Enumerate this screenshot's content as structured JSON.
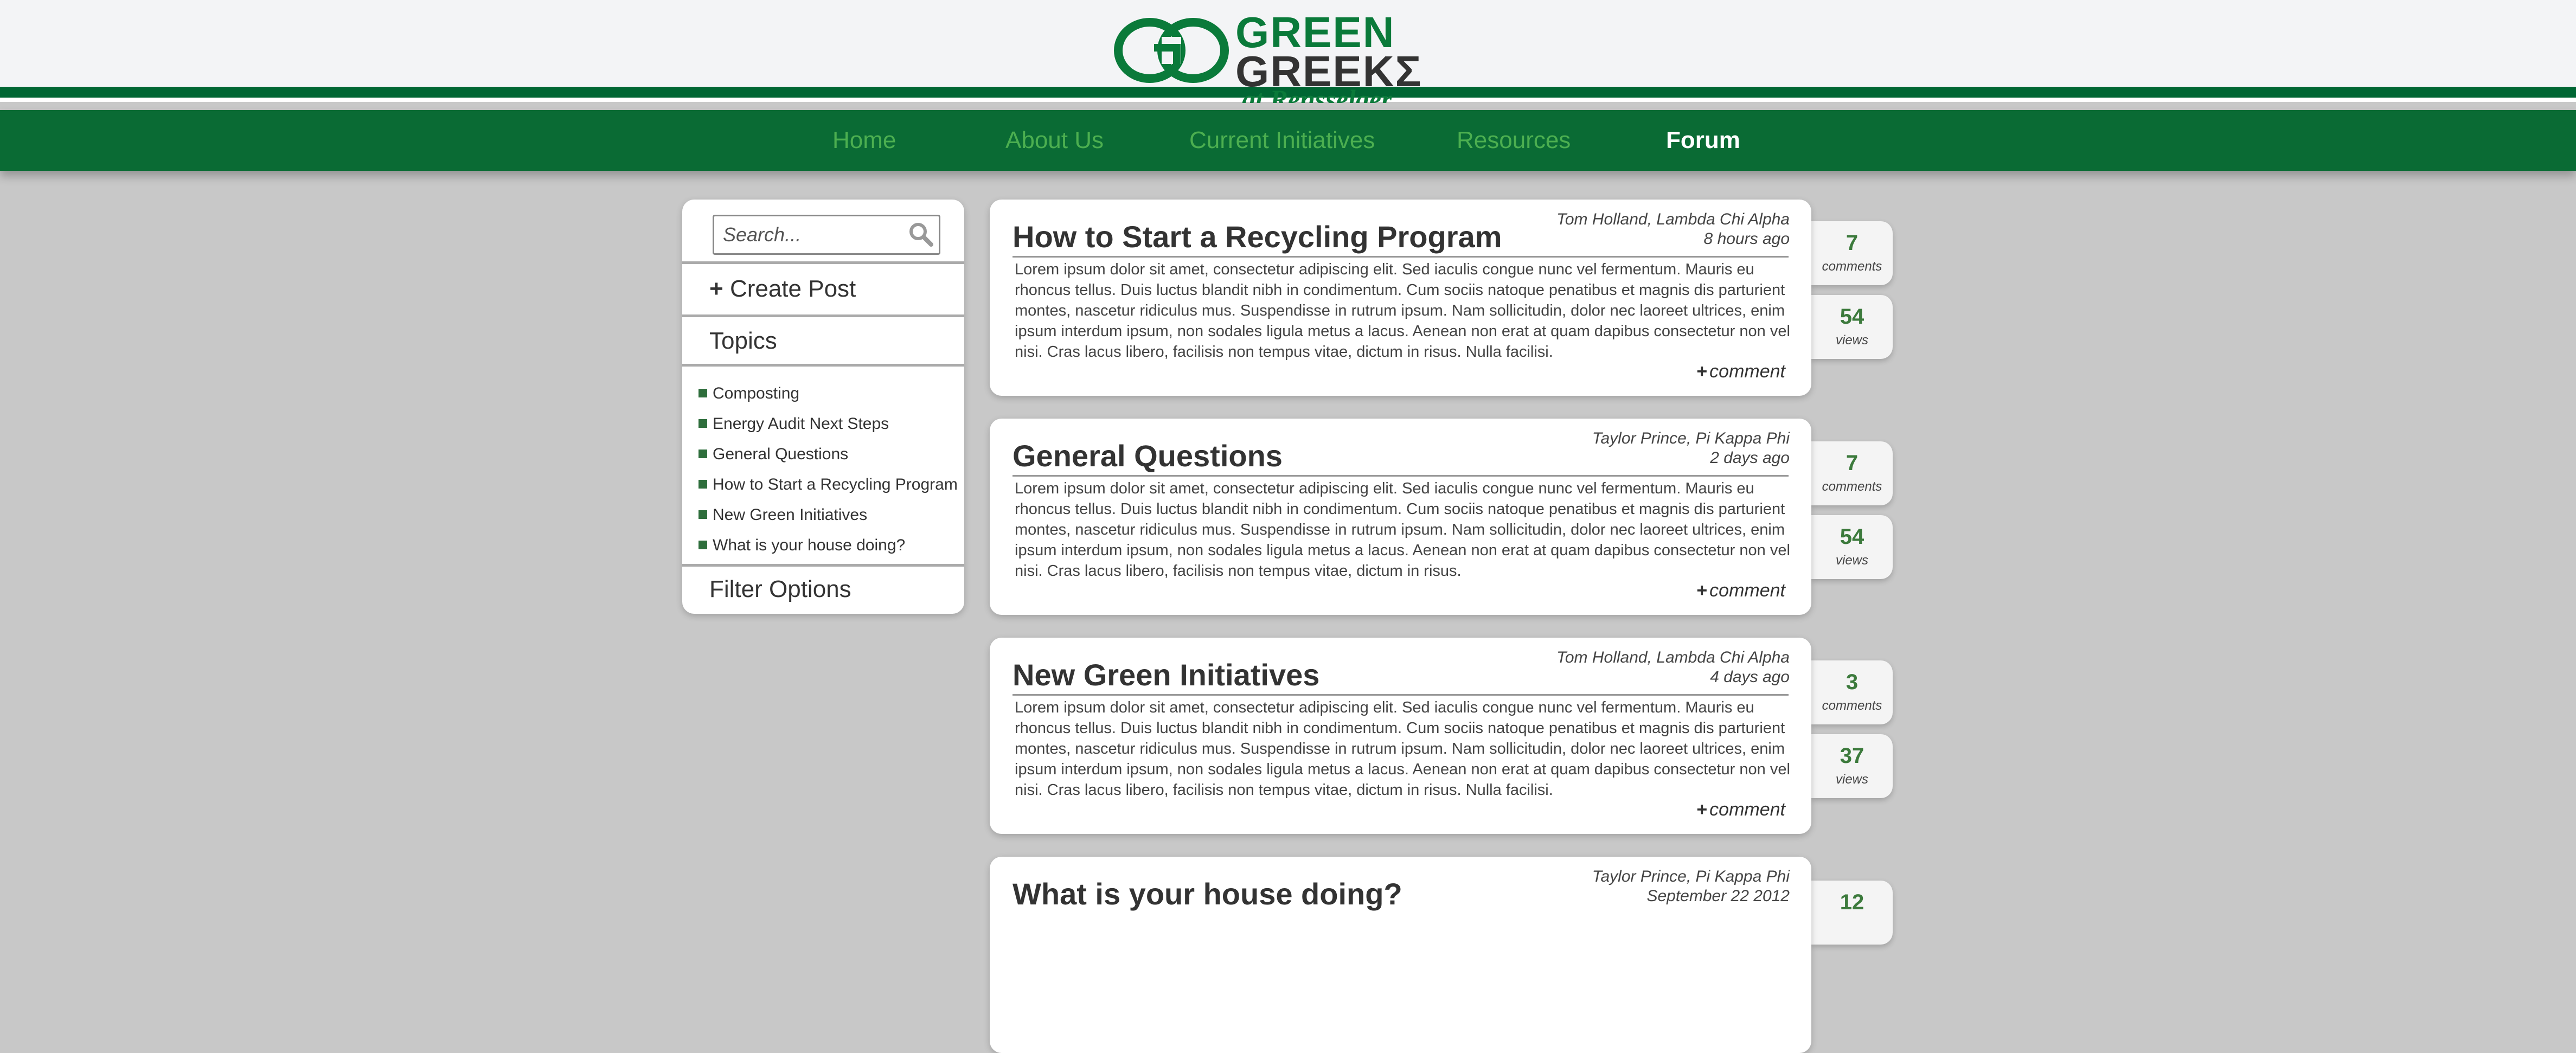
{
  "brand": {
    "line1": "GREEN",
    "line2": "GREEKΣ",
    "line3": "at Rensselaer",
    "colors": {
      "green": "#0a6b34",
      "accent": "#4caf50",
      "stat_green": "#3c7a3c"
    }
  },
  "nav": {
    "items": [
      {
        "label": "Home",
        "active": false
      },
      {
        "label": "About Us",
        "active": false
      },
      {
        "label": "Current Initiatives",
        "active": false
      },
      {
        "label": "Resources",
        "active": false
      },
      {
        "label": "Forum",
        "active": true
      }
    ]
  },
  "sidebar": {
    "search_placeholder": "Search...",
    "search_icon": "search-icon",
    "create_post": "Create Post",
    "topics_heading": "Topics",
    "topics": [
      "Composting",
      "Energy Audit Next Steps",
      "General Questions",
      "How to Start a Recycling Program",
      "New Green Initiatives",
      "What is your house doing?"
    ],
    "filter_heading": "Filter Options"
  },
  "posts": [
    {
      "title": "How to Start a Recycling Program",
      "author": "Tom Holland, Lambda Chi Alpha",
      "time": "8 hours ago",
      "body": "Lorem ipsum dolor sit amet, consectetur adipiscing elit. Sed iaculis congue nunc vel fermentum. Mauris eu rhoncus tellus. Duis luctus blandit nibh in condimentum. Cum sociis natoque penatibus et magnis dis parturient montes, nascetur ridiculus mus. Suspendisse in rutrum ipsum. Nam sollicitudin, dolor nec laoreet ultrices, enim ipsum interdum ipsum, non sodales ligula metus a lacus. Aenean non erat at quam dapibus consectetur non vel nisi. Cras lacus libero, facilisis non tempus vitae, dictum in risus. Nulla facilisi.",
      "comment_label": "comment",
      "comments": "7",
      "comments_label": "comments",
      "views": "54",
      "views_label": "views"
    },
    {
      "title": "General Questions",
      "author": "Taylor Prince, Pi Kappa Phi",
      "time": "2 days ago",
      "body": "Lorem ipsum dolor sit amet, consectetur adipiscing elit. Sed iaculis congue nunc vel fermentum. Mauris eu rhoncus tellus. Duis luctus blandit nibh in condimentum. Cum sociis natoque penatibus et magnis dis parturient montes, nascetur ridiculus mus. Suspendisse in rutrum ipsum. Nam sollicitudin, dolor nec laoreet ultrices, enim ipsum interdum ipsum, non sodales ligula metus a lacus. Aenean non erat at quam dapibus consectetur non vel nisi. Cras lacus libero, facilisis non tempus vitae, dictum in risus.",
      "comment_label": "comment",
      "comments": "7",
      "comments_label": "comments",
      "views": "54",
      "views_label": "views"
    },
    {
      "title": "New Green Initiatives",
      "author": "Tom Holland, Lambda Chi Alpha",
      "time": "4 days ago",
      "body": "Lorem ipsum dolor sit amet, consectetur adipiscing elit. Sed iaculis congue nunc vel fermentum. Mauris eu rhoncus tellus. Duis luctus blandit nibh in condimentum. Cum sociis natoque penatibus et magnis dis parturient montes, nascetur ridiculus mus. Suspendisse in rutrum ipsum. Nam sollicitudin, dolor nec laoreet ultrices, enim ipsum interdum ipsum, non sodales ligula metus a lacus. Aenean non erat at quam dapibus consectetur non vel nisi. Cras lacus libero, facilisis non tempus vitae, dictum in risus. Nulla facilisi.",
      "comment_label": "comment",
      "comments": "3",
      "comments_label": "comments",
      "views": "37",
      "views_label": "views"
    },
    {
      "title": "What is your house doing?",
      "author": "Taylor Prince, Pi Kappa Phi",
      "time": "September 22 2012",
      "comments": "12"
    }
  ]
}
